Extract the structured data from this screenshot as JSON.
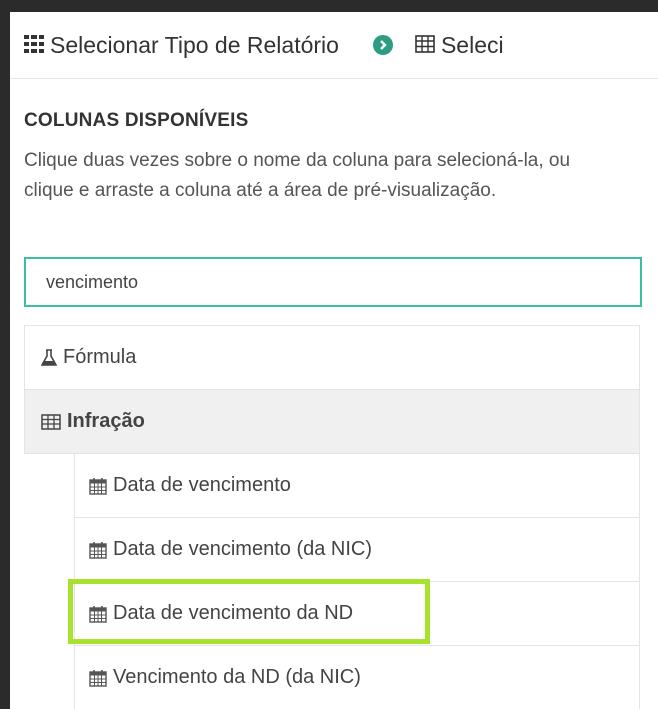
{
  "wizard": {
    "step1_label": "Selecionar Tipo de Relatório",
    "step2_label": "Seleci"
  },
  "section_title": "COLUNAS DISPONÍVEIS",
  "help_text": "Clique duas vezes sobre o nome da coluna para selecioná-la, ou clique e arraste a coluna até a área de pré-visualização.",
  "search": {
    "value": "vencimento"
  },
  "items": {
    "formula": "Fórmula",
    "group": "Infração",
    "col1": "Data de vencimento",
    "col2": "Data de vencimento (da NIC)",
    "col3": "Data de vencimento da ND",
    "col4": "Vencimento da ND (da NIC)"
  },
  "colors": {
    "accent": "#2d9d82",
    "highlight": "#a6e22e",
    "search_border": "#3bbfa0"
  }
}
